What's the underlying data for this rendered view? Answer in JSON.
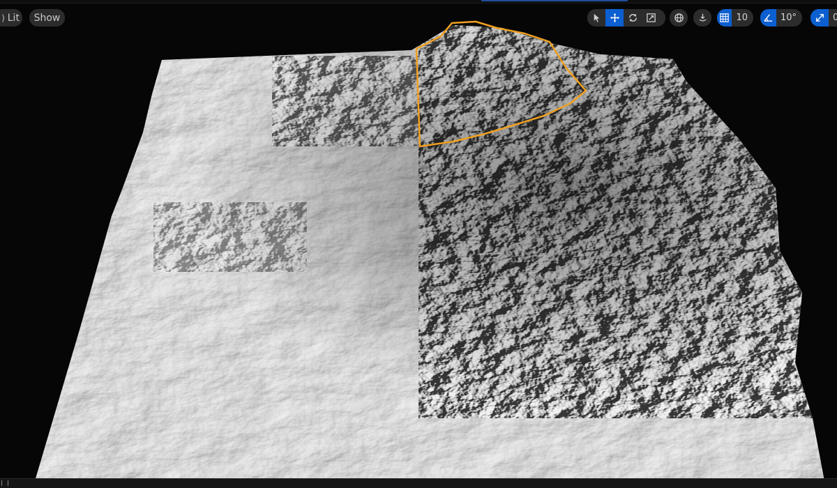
{
  "viewport": {
    "view_mode_label": "Lit",
    "show_label": "Show",
    "grid_snap_value": "10",
    "rotation_snap_value": "10°",
    "scale_snap_value": "0",
    "selection_outline_color": "#f0a020",
    "active_tool_color": "#0c5fd0",
    "icons": [
      "select-icon",
      "move-icon",
      "rotate-icon",
      "scale-icon",
      "world-space-icon",
      "surface-snap-icon",
      "grid-snap-icon",
      "rotation-snap-icon",
      "scale-snap-icon"
    ]
  }
}
